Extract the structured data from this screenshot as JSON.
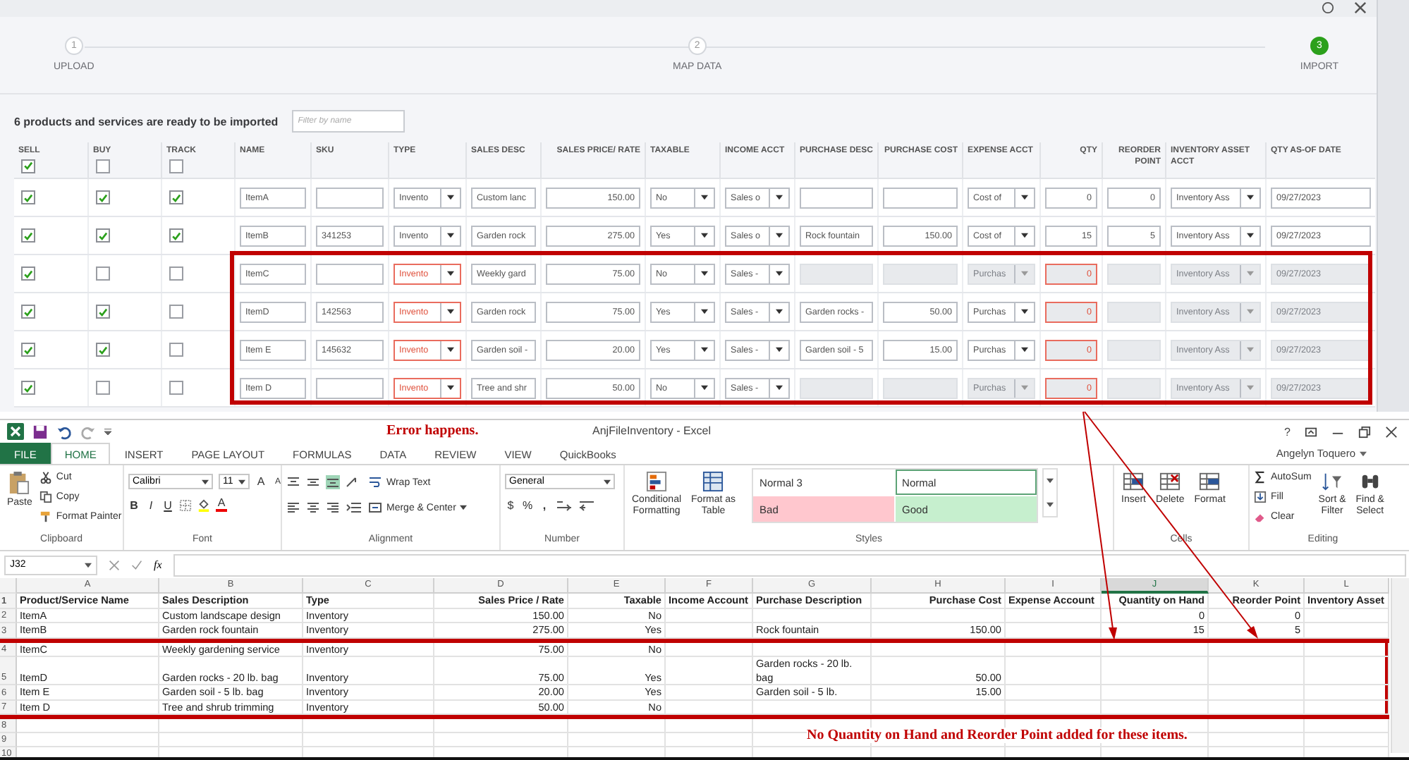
{
  "stepper": {
    "steps": [
      {
        "number": "1",
        "label": "UPLOAD",
        "selected": false
      },
      {
        "number": "2",
        "label": "MAP DATA",
        "selected": false
      },
      {
        "number": "3",
        "label": "IMPORT",
        "selected": true
      }
    ]
  },
  "import": {
    "summary": "6 products and services are ready to be imported",
    "filter": {
      "placeholder": "Filter by name"
    }
  },
  "table": {
    "columns": [
      {
        "label": "SELL",
        "kind": "check",
        "checked": true
      },
      {
        "label": "BUY",
        "kind": "check",
        "checked": false
      },
      {
        "label": "TRACK",
        "kind": "check",
        "checked": false
      },
      {
        "label": "NAME",
        "kind": "text"
      },
      {
        "label": "SKU",
        "kind": "text"
      },
      {
        "label": "TYPE",
        "kind": "select"
      },
      {
        "label": "SALES DESC",
        "kind": "text"
      },
      {
        "label": "SALES PRICE/ RATE",
        "kind": "number"
      },
      {
        "label": "TAXABLE",
        "kind": "select"
      },
      {
        "label": "INCOME ACCT",
        "kind": "select"
      },
      {
        "label": "PURCHASE DESC",
        "kind": "text"
      },
      {
        "label": "PURCHASE COST",
        "kind": "number"
      },
      {
        "label": "EXPENSE ACCT",
        "kind": "select"
      },
      {
        "label": "QTY",
        "kind": "number"
      },
      {
        "label": "REORDER POINT",
        "kind": "number"
      },
      {
        "label": "INVENTORY ASSET ACCT",
        "kind": "select"
      },
      {
        "label": "QTY AS-OF DATE",
        "kind": "text"
      }
    ],
    "rows": [
      {
        "cells": [
          {
            "checked": true
          },
          {
            "checked": true
          },
          {
            "checked": true
          },
          {
            "value": "ItemA",
            "disabled": false,
            "error": false
          },
          {
            "disabled": false,
            "error": false
          },
          {
            "value": "Invento",
            "disabled": false,
            "error": false
          },
          {
            "value": "Custom lanc",
            "disabled": false,
            "error": false
          },
          {
            "value": "150.00",
            "disabled": false,
            "error": false
          },
          {
            "value": "No",
            "disabled": false,
            "error": false
          },
          {
            "value": "Sales o",
            "disabled": false,
            "error": false
          },
          {
            "disabled": false,
            "error": false
          },
          {
            "disabled": false,
            "error": false
          },
          {
            "value": "Cost of",
            "disabled": false,
            "error": false
          },
          {
            "value": "0",
            "disabled": false,
            "error": false
          },
          {
            "value": "0",
            "disabled": false,
            "error": false
          },
          {
            "value": "Inventory Ass",
            "disabled": false,
            "error": false
          },
          {
            "value": "09/27/2023",
            "disabled": false,
            "error": false
          }
        ]
      },
      {
        "cells": [
          {
            "checked": true
          },
          {
            "checked": true
          },
          {
            "checked": true
          },
          {
            "value": "ItemB",
            "disabled": false,
            "error": false
          },
          {
            "value": "341253",
            "disabled": false,
            "error": false
          },
          {
            "value": "Invento",
            "disabled": false,
            "error": false
          },
          {
            "value": "Garden rock",
            "disabled": false,
            "error": false
          },
          {
            "value": "275.00",
            "disabled": false,
            "error": false
          },
          {
            "value": "Yes",
            "disabled": false,
            "error": false
          },
          {
            "value": "Sales o",
            "disabled": false,
            "error": false
          },
          {
            "value": "Rock fountain",
            "disabled": false,
            "error": false
          },
          {
            "value": "150.00",
            "disabled": false,
            "error": false
          },
          {
            "value": "Cost of",
            "disabled": false,
            "error": false
          },
          {
            "value": "15",
            "disabled": false,
            "error": false
          },
          {
            "value": "5",
            "disabled": false,
            "error": false
          },
          {
            "value": "Inventory Ass",
            "disabled": false,
            "error": false
          },
          {
            "value": "09/27/2023",
            "disabled": false,
            "error": false
          }
        ]
      },
      {
        "cells": [
          {
            "checked": true
          },
          {
            "checked": false
          },
          {
            "checked": false
          },
          {
            "value": "ItemC",
            "disabled": false,
            "error": false
          },
          {
            "disabled": false,
            "error": false
          },
          {
            "value": "Invento",
            "disabled": false,
            "error": true
          },
          {
            "value": "Weekly gard",
            "disabled": false,
            "error": false
          },
          {
            "value": "75.00",
            "disabled": false,
            "error": false
          },
          {
            "value": "No",
            "disabled": false,
            "error": false
          },
          {
            "value": "Sales -",
            "disabled": false,
            "error": false
          },
          {
            "disabled": true,
            "error": false
          },
          {
            "disabled": true,
            "error": false
          },
          {
            "value": "Purchas",
            "disabled": true,
            "error": false
          },
          {
            "value": "0",
            "disabled": true,
            "error": true
          },
          {
            "disabled": true,
            "error": false
          },
          {
            "value": "Inventory Ass",
            "disabled": true,
            "error": false
          },
          {
            "value": "09/27/2023",
            "disabled": true,
            "error": false
          }
        ]
      },
      {
        "cells": [
          {
            "checked": true
          },
          {
            "checked": true
          },
          {
            "checked": false
          },
          {
            "value": "ItemD",
            "disabled": false,
            "error": false
          },
          {
            "value": "142563",
            "disabled": false,
            "error": false
          },
          {
            "value": "Invento",
            "disabled": false,
            "error": true
          },
          {
            "value": "Garden rock",
            "disabled": false,
            "error": false
          },
          {
            "value": "75.00",
            "disabled": false,
            "error": false
          },
          {
            "value": "Yes",
            "disabled": false,
            "error": false
          },
          {
            "value": "Sales -",
            "disabled": false,
            "error": false
          },
          {
            "value": "Garden rocks -",
            "disabled": false,
            "error": false
          },
          {
            "value": "50.00",
            "disabled": false,
            "error": false
          },
          {
            "value": "Purchas",
            "disabled": false,
            "error": false
          },
          {
            "value": "0",
            "disabled": true,
            "error": true
          },
          {
            "disabled": true,
            "error": false
          },
          {
            "value": "Inventory Ass",
            "disabled": true,
            "error": false
          },
          {
            "value": "09/27/2023",
            "disabled": true,
            "error": false
          }
        ]
      },
      {
        "cells": [
          {
            "checked": true
          },
          {
            "checked": true
          },
          {
            "checked": false
          },
          {
            "value": "Item E",
            "disabled": false,
            "error": false
          },
          {
            "value": "145632",
            "disabled": false,
            "error": false
          },
          {
            "value": "Invento",
            "disabled": false,
            "error": true
          },
          {
            "value": "Garden soil -",
            "disabled": false,
            "error": false
          },
          {
            "value": "20.00",
            "disabled": false,
            "error": false
          },
          {
            "value": "Yes",
            "disabled": false,
            "error": false
          },
          {
            "value": "Sales -",
            "disabled": false,
            "error": false
          },
          {
            "value": "Garden soil - 5",
            "disabled": false,
            "error": false
          },
          {
            "value": "15.00",
            "disabled": false,
            "error": false
          },
          {
            "value": "Purchas",
            "disabled": false,
            "error": false
          },
          {
            "value": "0",
            "disabled": true,
            "error": true
          },
          {
            "disabled": true,
            "error": false
          },
          {
            "value": "Inventory Ass",
            "disabled": true,
            "error": false
          },
          {
            "value": "09/27/2023",
            "disabled": true,
            "error": false
          }
        ]
      },
      {
        "cells": [
          {
            "checked": true
          },
          {
            "checked": false
          },
          {
            "checked": false
          },
          {
            "value": "Item D",
            "disabled": false,
            "error": false
          },
          {
            "disabled": false,
            "error": false
          },
          {
            "value": "Invento",
            "disabled": false,
            "error": true
          },
          {
            "value": "Tree and shr",
            "disabled": false,
            "error": false
          },
          {
            "value": "50.00",
            "disabled": false,
            "error": false
          },
          {
            "value": "No",
            "disabled": false,
            "error": false
          },
          {
            "value": "Sales -",
            "disabled": false,
            "error": false
          },
          {
            "disabled": true,
            "error": false
          },
          {
            "disabled": true,
            "error": false
          },
          {
            "value": "Purchas",
            "disabled": true,
            "error": false
          },
          {
            "value": "0",
            "disabled": true,
            "error": true
          },
          {
            "disabled": true,
            "error": false
          },
          {
            "value": "Inventory Ass",
            "disabled": true,
            "error": false
          },
          {
            "value": "09/27/2023",
            "disabled": true,
            "error": false
          }
        ]
      }
    ]
  },
  "annotations": {
    "error_note": "Error happens.",
    "missing_note": "No Quantity on Hand and Reorder Point added for these items."
  },
  "excel": {
    "title": "AnjFileInventory - Excel",
    "help": "?",
    "user": "Angelyn Toquero",
    "tabs": [
      {
        "label": "FILE",
        "kind": "file",
        "selected": false
      },
      {
        "label": "HOME",
        "kind": "tab",
        "selected": true
      },
      {
        "label": "INSERT",
        "kind": "tab",
        "selected": false
      },
      {
        "label": "PAGE LAYOUT",
        "kind": "tab",
        "selected": false
      },
      {
        "label": "FORMULAS",
        "kind": "tab",
        "selected": false
      },
      {
        "label": "DATA",
        "kind": "tab",
        "selected": false
      },
      {
        "label": "REVIEW",
        "kind": "tab",
        "selected": false
      },
      {
        "label": "VIEW",
        "kind": "tab",
        "selected": false
      },
      {
        "label": "QuickBooks",
        "kind": "tab",
        "selected": false
      }
    ],
    "ribbon": {
      "clipboard": {
        "label": "Clipboard",
        "paste": "Paste",
        "cut": "Cut",
        "copy": "Copy",
        "format_painter": "Format Painter"
      },
      "font": {
        "label": "Font",
        "family": "Calibri",
        "size": "11",
        "grow": "A",
        "shrink": "A",
        "bold": "B",
        "italic": "I",
        "underline": "U",
        "font_color": "A"
      },
      "alignment": {
        "label": "Alignment",
        "wrap": "Wrap Text",
        "merge": "Merge & Center"
      },
      "number": {
        "label": "Number",
        "format": "General",
        "currency": "$",
        "percent": "%",
        "comma": ","
      },
      "styles": {
        "label": "Styles",
        "conditional": [
          "Conditional",
          "Formatting"
        ],
        "table": [
          "Format as",
          "Table"
        ],
        "gallery": [
          {
            "label": "Normal 3",
            "color": "#ffffff",
            "selected": false
          },
          {
            "label": "Normal",
            "color": "#ffffff",
            "selected": true
          },
          {
            "label": "Bad",
            "color": "#ffc7ce",
            "selected": false
          },
          {
            "label": "Good",
            "color": "#c6efce",
            "selected": false
          }
        ]
      },
      "cells": {
        "label": "Cells",
        "buttons": [
          "Insert",
          "Delete",
          "Format"
        ]
      },
      "editing": {
        "label": "Editing",
        "autosum": "AutoSum",
        "fill": "Fill",
        "clear": "Clear",
        "sort": [
          "Sort &",
          "Filter"
        ],
        "find": [
          "Find &",
          "Select"
        ]
      }
    },
    "name_box": "J32",
    "function_label": "fx",
    "sheet": {
      "columns": [
        {
          "letter": "A",
          "kind": "text",
          "selected": false
        },
        {
          "letter": "B",
          "kind": "text",
          "selected": false
        },
        {
          "letter": "C",
          "kind": "text",
          "selected": false
        },
        {
          "letter": "D",
          "kind": "number",
          "selected": false
        },
        {
          "letter": "E",
          "kind": "number",
          "selected": false
        },
        {
          "letter": "F",
          "kind": "text",
          "selected": false
        },
        {
          "letter": "G",
          "kind": "text",
          "selected": false
        },
        {
          "letter": "H",
          "kind": "number",
          "selected": false
        },
        {
          "letter": "I",
          "kind": "text",
          "selected": false
        },
        {
          "letter": "J",
          "kind": "number",
          "selected": true
        },
        {
          "letter": "K",
          "kind": "number",
          "selected": false
        },
        {
          "letter": "L",
          "kind": "text",
          "selected": false
        }
      ],
      "rows": [
        {
          "number": "1",
          "header": true,
          "highlighted": false,
          "cells": {
            "A": "Product/Service Name",
            "B": "Sales Description",
            "C": "Type",
            "D": "Sales Price / Rate",
            "E": "Taxable",
            "F": "Income Account",
            "G": "Purchase Description",
            "H": "Purchase Cost",
            "I": "Expense Account",
            "J": "Quantity on Hand",
            "K": "Reorder Point",
            "L": "Inventory Asset"
          }
        },
        {
          "number": "2",
          "header": false,
          "highlighted": false,
          "cells": {
            "A": "ItemA",
            "B": "Custom landscape design",
            "C": "Inventory",
            "D": "150.00",
            "E": "No",
            "J": "0",
            "K": "0"
          }
        },
        {
          "number": "3",
          "header": false,
          "highlighted": false,
          "cells": {
            "A": "ItemB",
            "B": "Garden rock fountain",
            "C": "Inventory",
            "D": "275.00",
            "E": "Yes",
            "G": "Rock fountain",
            "H": "150.00",
            "J": "15",
            "K": "5"
          }
        },
        {
          "number": "4",
          "header": false,
          "highlighted": true,
          "cells": {
            "A": "ItemC",
            "B": "Weekly gardening service",
            "C": "Inventory",
            "D": "75.00",
            "E": "No"
          }
        },
        {
          "number": "5",
          "header": false,
          "highlighted": true,
          "cells": {
            "A": "ItemD",
            "B": "Garden rocks - 20 lb. bag",
            "C": "Inventory",
            "D": "75.00",
            "E": "Yes",
            "G": "Garden rocks - 20 lb. bag",
            "H": "50.00"
          }
        },
        {
          "number": "6",
          "header": false,
          "highlighted": true,
          "cells": {
            "A": "Item E",
            "B": "Garden soil - 5 lb. bag",
            "C": "Inventory",
            "D": "20.00",
            "E": "Yes",
            "G": "Garden soil - 5 lb.",
            "H": "15.00"
          }
        },
        {
          "number": "7",
          "header": false,
          "highlighted": true,
          "cells": {
            "A": "Item D",
            "B": "Tree and shrub trimming",
            "C": "Inventory",
            "D": "50.00",
            "E": "No"
          }
        },
        {
          "number": "8",
          "header": false,
          "highlighted": false
        },
        {
          "number": "9",
          "header": false,
          "highlighted": false
        },
        {
          "number": "10",
          "header": false,
          "highlighted": false
        }
      ]
    }
  }
}
